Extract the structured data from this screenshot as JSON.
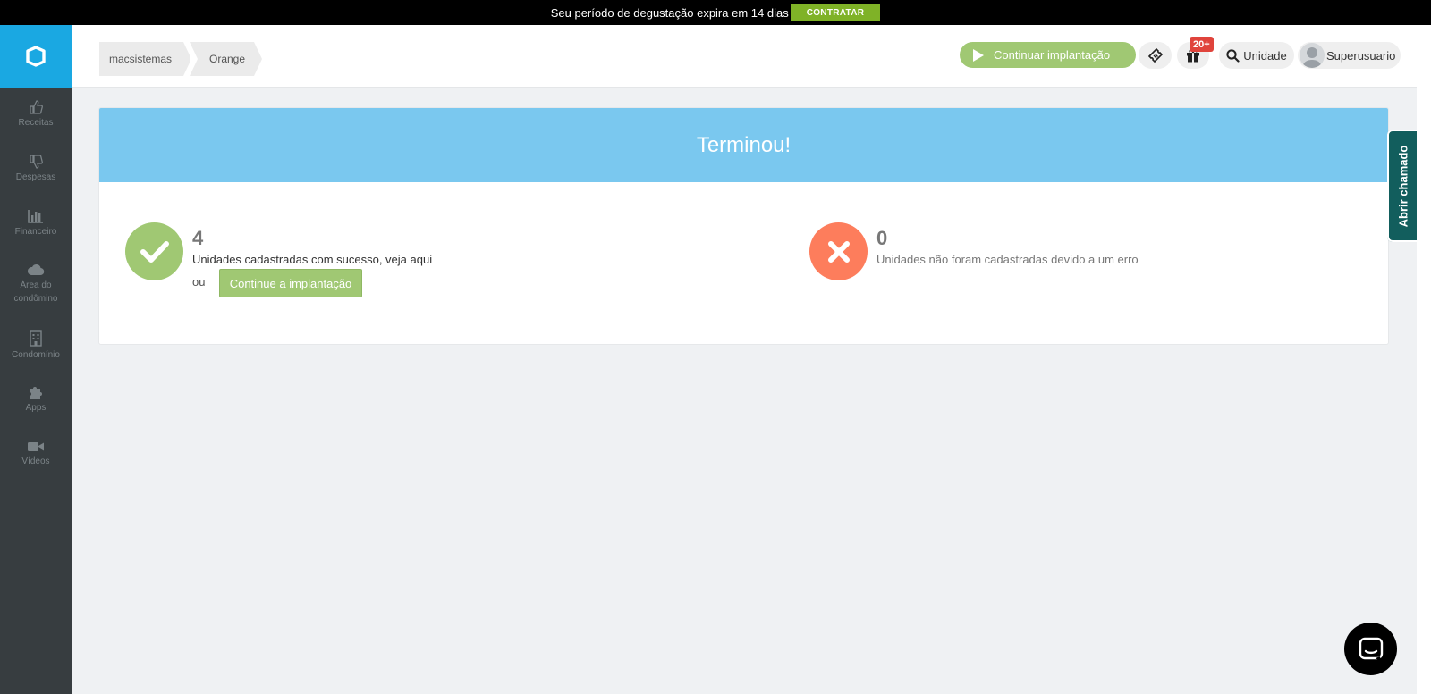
{
  "trial_banner": {
    "text": "Seu período de degustação expira em 14 dias",
    "cta_label": "CONTRATAR",
    "cta_color": "#7fb227"
  },
  "sidebar": {
    "logo_icon": "app-logo-icon",
    "items": [
      {
        "label": "Receitas",
        "icon": "thumbs-up-icon"
      },
      {
        "label": "Despesas",
        "icon": "thumbs-down-icon"
      },
      {
        "label": "Financeiro",
        "icon": "bar-chart-icon"
      },
      {
        "label": "Área do condômino",
        "icon": "cloud-icon"
      },
      {
        "label": "Condomínio",
        "icon": "building-icon"
      },
      {
        "label": "Apps",
        "icon": "puzzle-icon"
      },
      {
        "label": "Vídeos",
        "icon": "video-camera-icon"
      }
    ]
  },
  "header": {
    "breadcrumb": [
      "macsistemas",
      "Orange"
    ],
    "continue_label": "Continuar implantação",
    "gift_badge": "20+",
    "unit_label": "Unidade",
    "user_label": "Superusuario"
  },
  "result": {
    "title": "Terminou!",
    "success_count": "4",
    "success_text": "Unidades cadastradas com sucesso, veja aqui",
    "or_text": "ou",
    "continue_button": "Continue a implantação",
    "error_count": "0",
    "error_text": "Unidades não foram cadastradas devido a um erro"
  },
  "side_tab": {
    "label": "Abrir chamado"
  },
  "colors": {
    "brand_blue": "#1aa8e2",
    "header_blue": "#7ac8ef",
    "success_green": "#a0c873",
    "error_orange": "#fd7d5c",
    "side_tab_teal": "#125e5d"
  }
}
